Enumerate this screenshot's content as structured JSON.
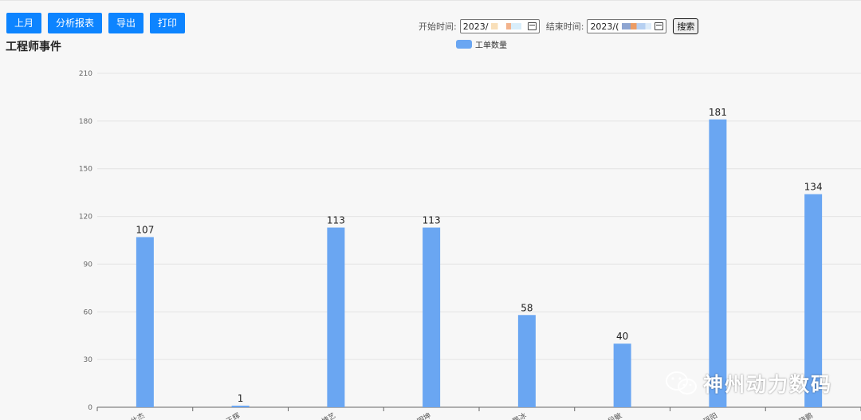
{
  "toolbar": {
    "last_month_label": "上月",
    "analysis_report_label": "分析报表",
    "export_label": "导出",
    "print_label": "打印"
  },
  "filters": {
    "start_label": "开始时间:",
    "start_value": "2023/",
    "end_label": "结束时间:",
    "end_value": "2023/(",
    "search_label": "搜索",
    "icon": "calendar-icon"
  },
  "page": {
    "title": "工程师事件"
  },
  "watermark": {
    "text": "神州动力数码",
    "icon": "wechat-icon"
  },
  "chart_data": {
    "type": "bar",
    "categories": [
      "仕杰",
      "王辉",
      "坤艺",
      "明坤",
      "鹏冰",
      "段敏",
      "瑶阳",
      "晓鹏"
    ],
    "series": [
      {
        "name": "工单数量",
        "values": [
          107,
          1,
          113,
          113,
          58,
          40,
          181,
          134
        ],
        "color": "#6aa6f2"
      }
    ],
    "yticks": [
      0,
      30,
      60,
      90,
      120,
      150,
      180,
      210
    ],
    "ylim": [
      0,
      210
    ],
    "grid": true,
    "legend_position": "top-center"
  }
}
